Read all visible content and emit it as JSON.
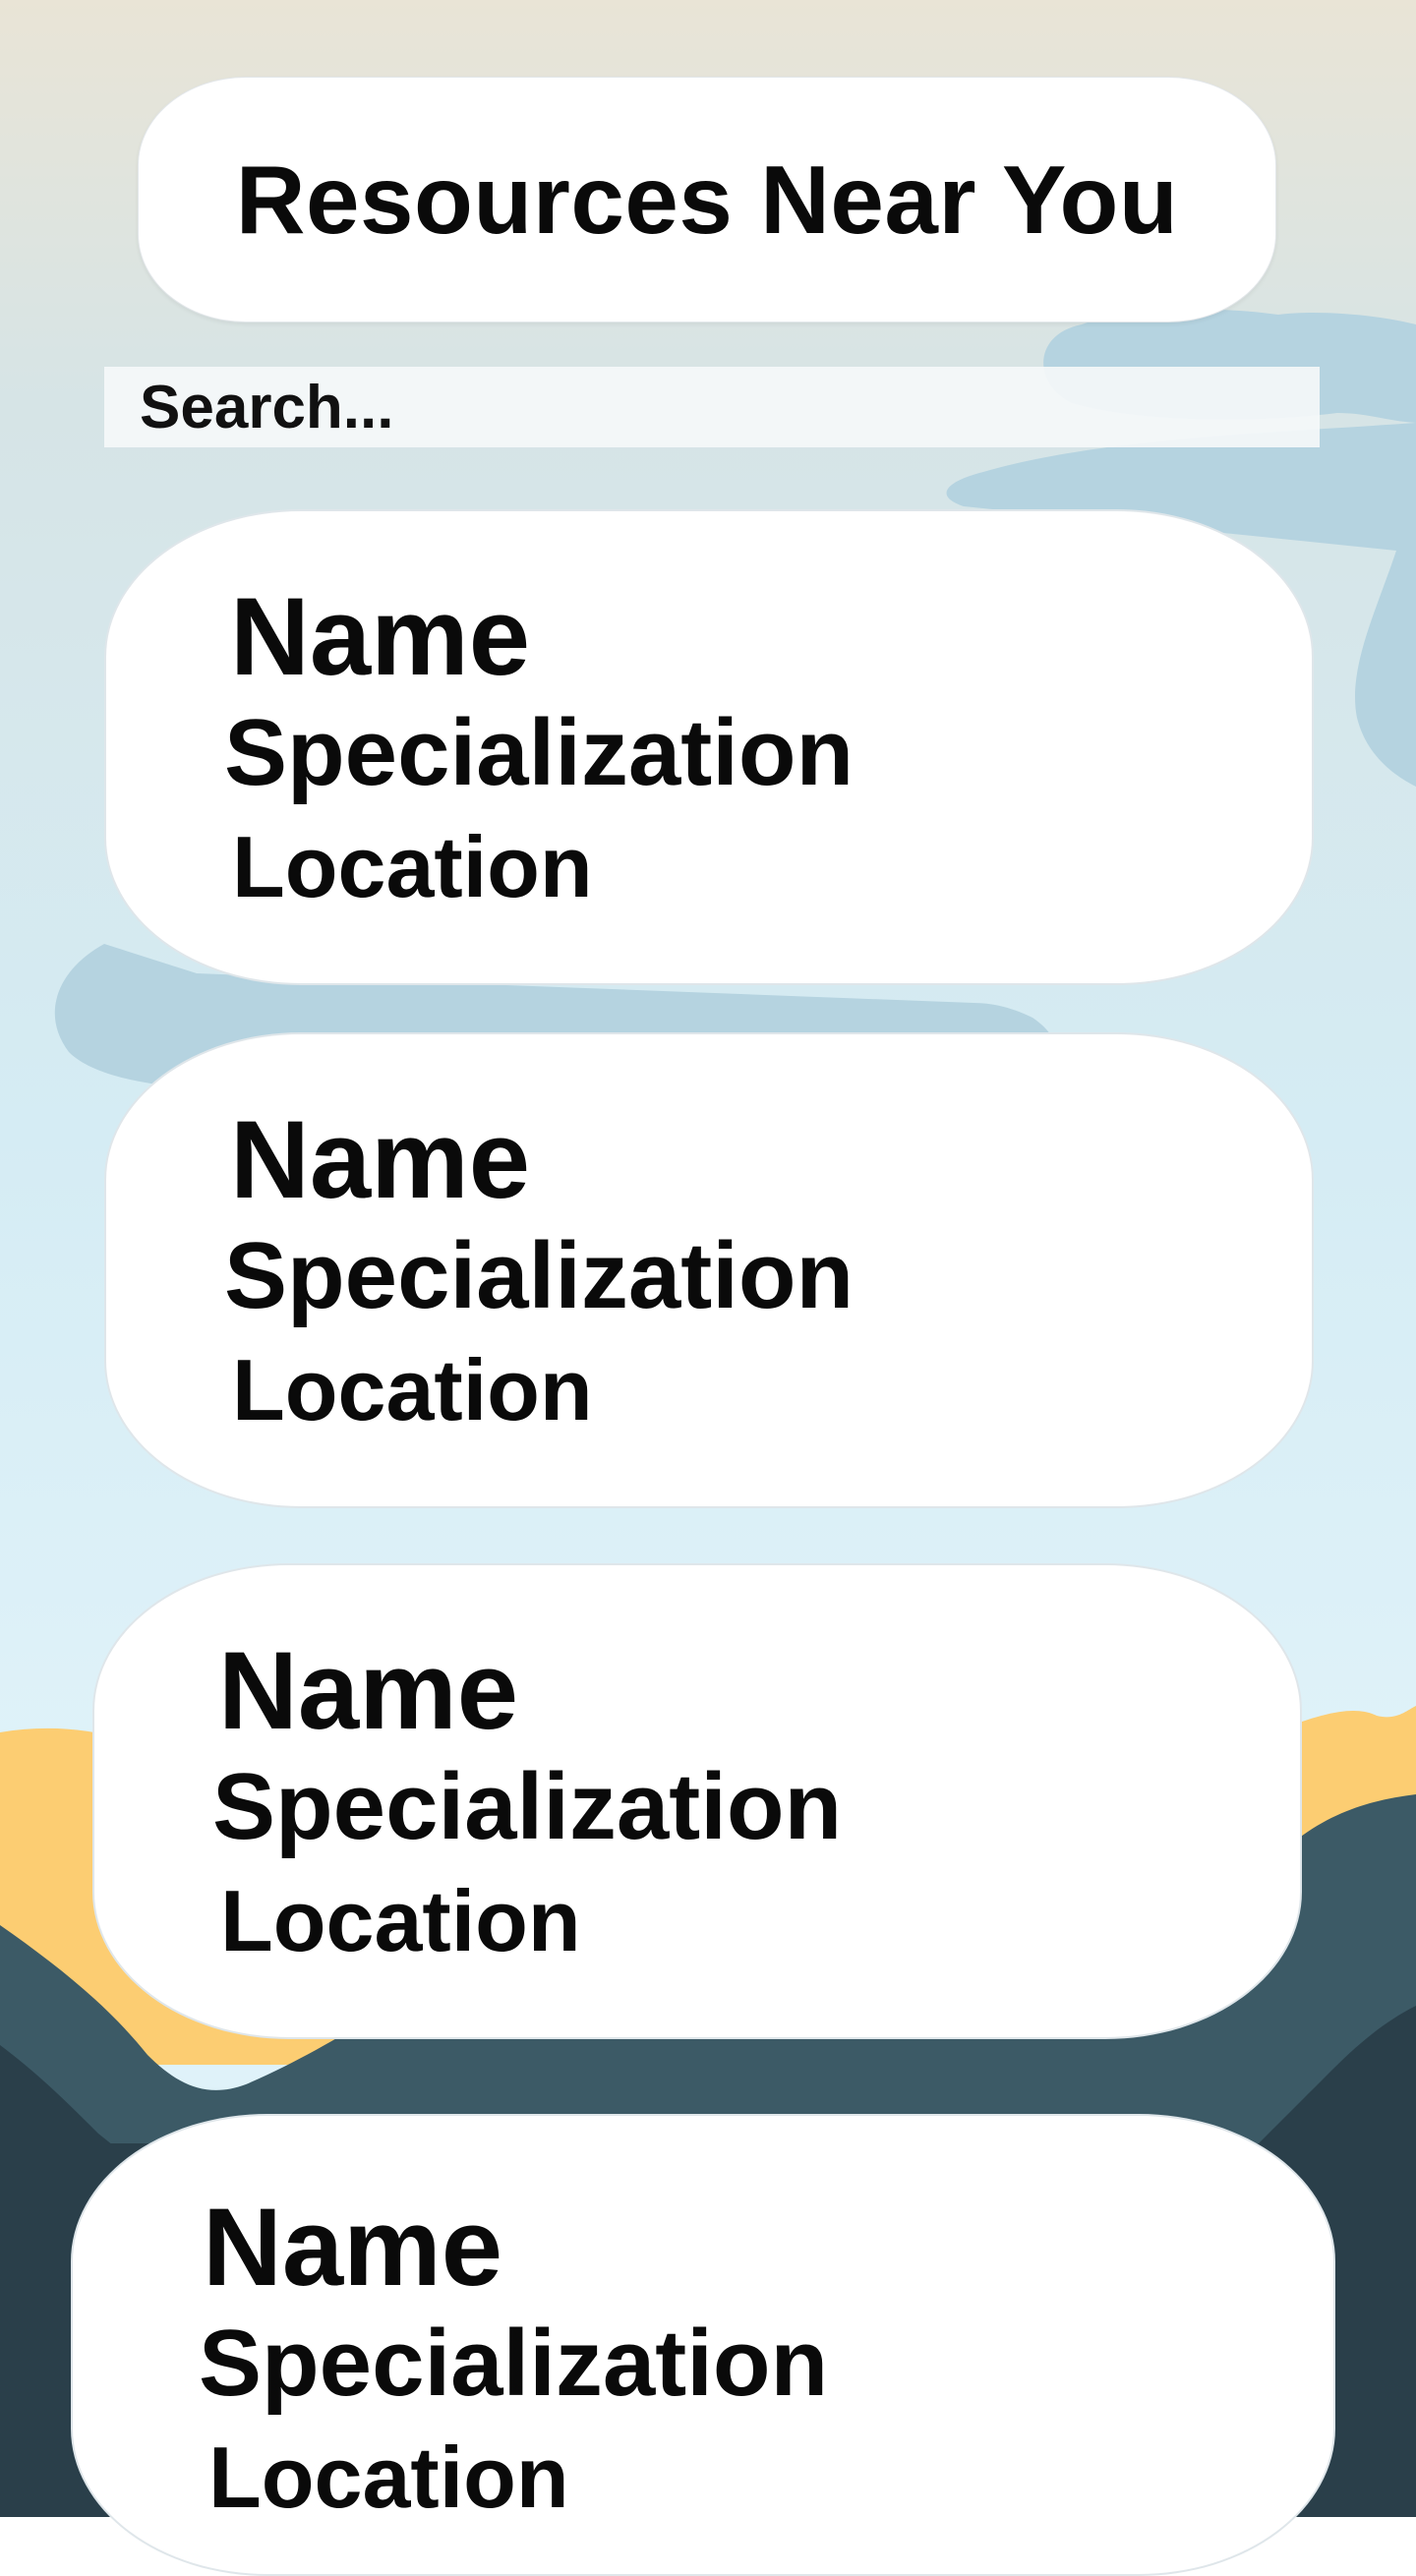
{
  "header": {
    "title": "Resources Near You"
  },
  "search": {
    "placeholder": "Search..."
  },
  "resources": [
    {
      "name": "Name",
      "specialization": "Specialization",
      "location": "Location"
    },
    {
      "name": "Name",
      "specialization": "Specialization",
      "location": "Location"
    },
    {
      "name": "Name",
      "specialization": "Specialization",
      "location": "Location"
    },
    {
      "name": "Name",
      "specialization": "Specialization",
      "location": "Location"
    }
  ],
  "colors": {
    "sky_top": "#e8e3d6",
    "sky_mid": "#d4e8ef",
    "sky_bottom": "#dff2f8",
    "cloud": "#b5d3e0",
    "sand": "#fccd72",
    "mountain_mid": "#3c5a66",
    "mountain_dark": "#2a3f4a",
    "card_background": "#ffffff"
  }
}
